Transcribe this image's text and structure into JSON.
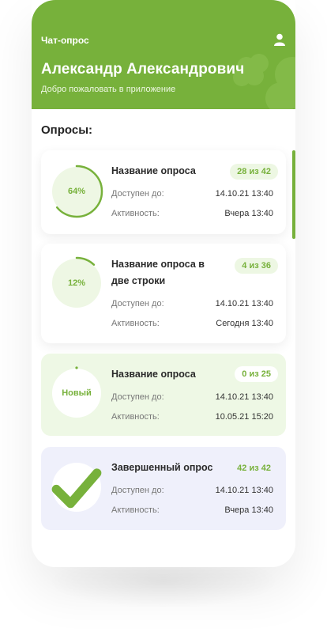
{
  "header": {
    "app_title": "Чат-опрос",
    "user_name": "Александр Александрович",
    "welcome": "Добро пожаловать в приложение",
    "user_icon": "user-icon",
    "color": "#77b13b"
  },
  "section_title": "Опросы:",
  "labels": {
    "available": "Доступен до:",
    "activity": "Активность:"
  },
  "surveys": [
    {
      "title": "Название опроса",
      "progress_text": "64%",
      "progress": 0.64,
      "badge": "28 из 42",
      "available": "14.10.21 13:40",
      "activity": "Вчера 13:40"
    },
    {
      "title": "Название опроса в две строки",
      "progress_text": "12%",
      "progress": 0.12,
      "badge": "4 из 36",
      "available": "14.10.21 13:40",
      "activity": "Сегодня 13:40"
    },
    {
      "title": "Название опроса",
      "progress_text": "Новый",
      "progress": 0,
      "badge": "0 из 25",
      "available": "14.10.21 13:40",
      "activity": "10.05.21 15:20"
    },
    {
      "title": "Завершенный опрос",
      "progress_text": "",
      "icon": "checkmark-icon",
      "badge": "42 из 42",
      "available": "14.10.21 13:40",
      "activity": "Вчера 13:40"
    }
  ]
}
